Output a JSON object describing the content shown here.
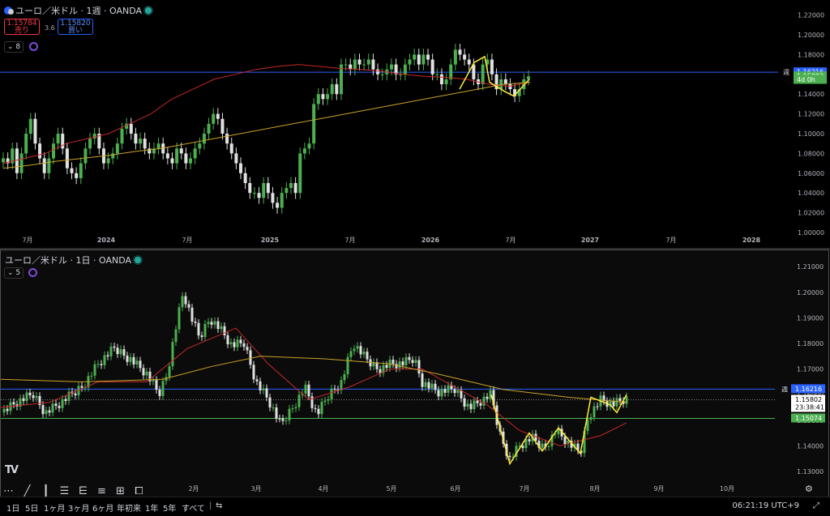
{
  "pane1": {
    "title": "ユーロ／米ドル · 1週 · OANDA",
    "sell_price": "1.15784",
    "sell_label": "売り",
    "spread": "3.6",
    "buy_price": "1.15820",
    "buy_label": "買い",
    "indicator_count": "8"
  },
  "pane2": {
    "title": "ユーロ／米ドル · 1日 · OANDA",
    "indicator_count": "5"
  },
  "bottom_bar": {
    "timeframes": [
      "1日",
      "5日",
      "1ヶ月",
      "3ヶ月",
      "6ヶ月",
      "年初来",
      "1年",
      "5年",
      "すべて"
    ],
    "clock": "06:21:19 UTC+9"
  },
  "colors": {
    "up": "#4caf50",
    "down": "#e0e0e0",
    "ma_fast": "#c62828",
    "ma_slow": "#c9a227",
    "zigzag": "#ffeb3b",
    "blue_line": "#2962ff",
    "green_line": "#4caf50"
  },
  "chart_data": [
    {
      "type": "candlestick",
      "title": "ユーロ／米ドル · 1週 · OANDA",
      "ylim": [
        1.0,
        1.225
      ],
      "y_ticks": [
        "1.22000",
        "1.20000",
        "1.18000",
        "1.16000",
        "1.14000",
        "1.12000",
        "1.10000",
        "1.08000",
        "1.06000",
        "1.04000",
        "1.02000",
        "1.00000"
      ],
      "x_ticks": [
        "7月",
        "2024",
        "7月",
        "2025",
        "7月",
        "2026",
        "7月",
        "2027",
        "7月",
        "2028"
      ],
      "price_labels": [
        {
          "text": "1.16216",
          "value": 1.16216,
          "color": "#2962ff"
        },
        {
          "text": "1.15802",
          "value": 1.15802,
          "color": "#4caf50"
        },
        {
          "text": "4d 0h",
          "value": 1.1545,
          "color": "#4caf50"
        }
      ],
      "line_label": "週",
      "horizontal_line": 1.16216,
      "series": [
        {
          "name": "close",
          "values": [
            1.075,
            1.07,
            1.085,
            1.06,
            1.08,
            1.1,
            1.115,
            1.09,
            1.075,
            1.06,
            1.075,
            1.09,
            1.1,
            1.085,
            1.065,
            1.06,
            1.055,
            1.07,
            1.085,
            1.095,
            1.1,
            1.085,
            1.07,
            1.075,
            1.08,
            1.09,
            1.105,
            1.11,
            1.1,
            1.09,
            1.095,
            1.085,
            1.08,
            1.085,
            1.09,
            1.08,
            1.075,
            1.07,
            1.085,
            1.08,
            1.07,
            1.075,
            1.085,
            1.09,
            1.1,
            1.11,
            1.12,
            1.115,
            1.1,
            1.09,
            1.08,
            1.07,
            1.06,
            1.05,
            1.04,
            1.04,
            1.035,
            1.05,
            1.04,
            1.03,
            1.025,
            1.04,
            1.045,
            1.05,
            1.04,
            1.08,
            1.085,
            1.09,
            1.13,
            1.14,
            1.135,
            1.14,
            1.15,
            1.14,
            1.17,
            1.17,
            1.165,
            1.175,
            1.17,
            1.17,
            1.175,
            1.165,
            1.16,
            1.16,
            1.165,
            1.17,
            1.16,
            1.16,
            1.17,
            1.175,
            1.18,
            1.17,
            1.18,
            1.175,
            1.16,
            1.16,
            1.15,
            1.155,
            1.17,
            1.185,
            1.18,
            1.175,
            1.17,
            1.155,
            1.15,
            1.17,
            1.175,
            1.16,
            1.145,
            1.155,
            1.15,
            1.145,
            1.138,
            1.145,
            1.155,
            1.158
          ]
        },
        {
          "name": "MA fast",
          "values": [
            1.07,
            1.075,
            1.08,
            1.09,
            1.095,
            1.1,
            1.11,
            1.12,
            1.135,
            1.145,
            1.155,
            1.16,
            1.165,
            1.168,
            1.17,
            1.168,
            1.166,
            1.165,
            1.163,
            1.16,
            1.158,
            1.157,
            1.155,
            1.15,
            1.148,
            1.152
          ]
        },
        {
          "name": "MA slow",
          "values": [
            1.065,
            1.068,
            1.072,
            1.075,
            1.078,
            1.082,
            1.085,
            1.09,
            1.095,
            1.1,
            1.105,
            1.11,
            1.115,
            1.12,
            1.125,
            1.13,
            1.135,
            1.14,
            1.145,
            1.15,
            1.152
          ]
        }
      ]
    },
    {
      "type": "candlestick",
      "title": "ユーロ／米ドル · 1日 · OANDA",
      "ylim": [
        1.125,
        1.214
      ],
      "y_ticks": [
        "1.21000",
        "1.20000",
        "1.19000",
        "1.18000",
        "1.17000",
        "1.16000",
        "1.15000",
        "1.14000",
        "1.13000"
      ],
      "x_ticks": [
        "2月",
        "3月",
        "4月",
        "5月",
        "6月",
        "7月",
        "8月",
        "9月",
        "10月"
      ],
      "price_labels": [
        {
          "text": "1.16216",
          "value": 1.16216,
          "color": "#2962ff"
        },
        {
          "text": "1.15802",
          "value": 1.15802,
          "color": "#ffffff"
        },
        {
          "text": "23:38:41",
          "value": 1.1547,
          "color": "#ffffff"
        },
        {
          "text": "1.15074",
          "value": 1.15074,
          "color": "#4caf50"
        }
      ],
      "line_label": "週",
      "horizontal_lines": [
        1.16216,
        1.15802,
        1.15074
      ]
    }
  ]
}
